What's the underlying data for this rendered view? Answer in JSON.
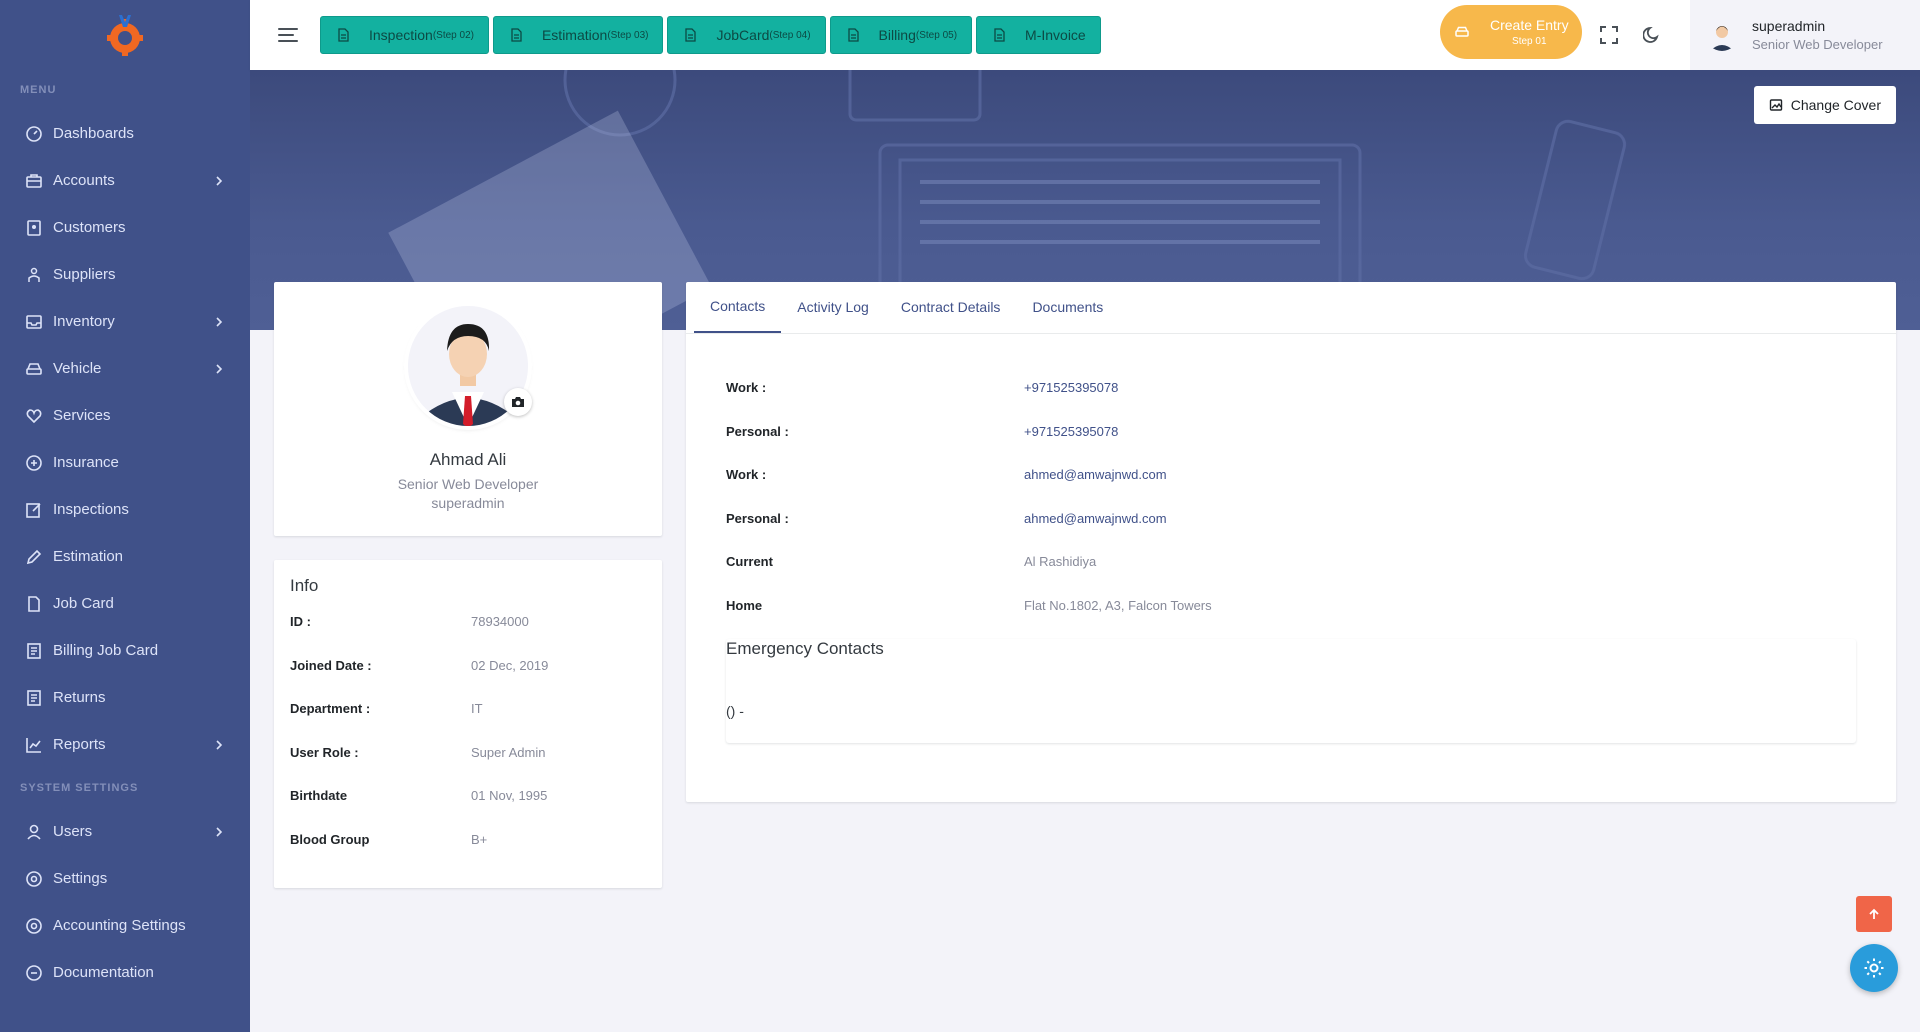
{
  "sidebar": {
    "menu_title": "MENU",
    "system_title": "SYSTEM SETTINGS",
    "items": [
      {
        "label": "Dashboards",
        "icon": "dashboard-icon",
        "has_children": false
      },
      {
        "label": "Accounts",
        "icon": "briefcase-icon",
        "has_children": true
      },
      {
        "label": "Customers",
        "icon": "contact-book-icon",
        "has_children": false
      },
      {
        "label": "Suppliers",
        "icon": "team-icon",
        "has_children": false
      },
      {
        "label": "Inventory",
        "icon": "inbox-icon",
        "has_children": true
      },
      {
        "label": "Vehicle",
        "icon": "car-icon",
        "has_children": true
      },
      {
        "label": "Services",
        "icon": "service-icon",
        "has_children": false
      },
      {
        "label": "Insurance",
        "icon": "insurance-icon",
        "has_children": false
      },
      {
        "label": "Inspections",
        "icon": "edit-box-icon",
        "has_children": false
      },
      {
        "label": "Estimation",
        "icon": "edit-icon",
        "has_children": false
      },
      {
        "label": "Job Card",
        "icon": "file-icon",
        "has_children": false
      },
      {
        "label": "Billing Job Card",
        "icon": "file-list-icon",
        "has_children": false
      },
      {
        "label": "Returns",
        "icon": "file-list-icon",
        "has_children": false
      },
      {
        "label": "Reports",
        "icon": "line-chart-icon",
        "has_children": true
      }
    ],
    "system_items": [
      {
        "label": "Users",
        "icon": "user-icon",
        "has_children": true
      },
      {
        "label": "Settings",
        "icon": "settings-icon",
        "has_children": false
      },
      {
        "label": "Accounting Settings",
        "icon": "settings-icon",
        "has_children": false
      },
      {
        "label": "Documentation",
        "icon": "doc-icon",
        "has_children": false
      }
    ]
  },
  "topbar": {
    "steps": [
      {
        "label": "Inspection",
        "step": "(Step 02)"
      },
      {
        "label": "Estimation",
        "step": "(Step 03)"
      },
      {
        "label": "JobCard",
        "step": "(Step 04)"
      },
      {
        "label": "Billing",
        "step": "(Step 05)"
      },
      {
        "label": "M-Invoice",
        "step": ""
      }
    ],
    "create_entry": {
      "label": "Create Entry",
      "step": "Step 01"
    },
    "user": {
      "name": "superadmin",
      "role": "Senior Web Developer"
    }
  },
  "cover": {
    "change_cover_label": "Change Cover"
  },
  "profile": {
    "name": "Ahmad Ali",
    "role": "Senior Web Developer",
    "username": "superadmin"
  },
  "info": {
    "title": "Info",
    "rows": [
      {
        "key": "ID :",
        "value": "78934000"
      },
      {
        "key": "Joined Date :",
        "value": "02 Dec, 2019"
      },
      {
        "key": "Department :",
        "value": "IT"
      },
      {
        "key": "User Role :",
        "value": "Super Admin"
      },
      {
        "key": "Birthdate",
        "value": "01 Nov, 1995"
      },
      {
        "key": "Blood Group",
        "value": "B+"
      }
    ]
  },
  "tabs": [
    "Contacts",
    "Activity Log",
    "Contract Details",
    "Documents"
  ],
  "contacts": [
    {
      "key": "Work :",
      "value": "+971525395078",
      "muted": false
    },
    {
      "key": "Personal :",
      "value": "+971525395078",
      "muted": false
    },
    {
      "key": "Work :",
      "value": "ahmed@amwajnwd.com",
      "muted": false
    },
    {
      "key": "Personal :",
      "value": "ahmed@amwajnwd.com",
      "muted": false
    },
    {
      "key": "Current",
      "value": "Al Rashidiya",
      "muted": true
    },
    {
      "key": "Home",
      "value": "Flat No.1802, A3, Falcon Towers",
      "muted": true
    }
  ],
  "emergency": {
    "title": "Emergency Contacts",
    "value": "() -"
  },
  "colors": {
    "sidebar": "#405189",
    "step": "#13b1a0",
    "create": "#f7b84b",
    "scroll_top": "#f06548",
    "fab": "#299cdb"
  }
}
